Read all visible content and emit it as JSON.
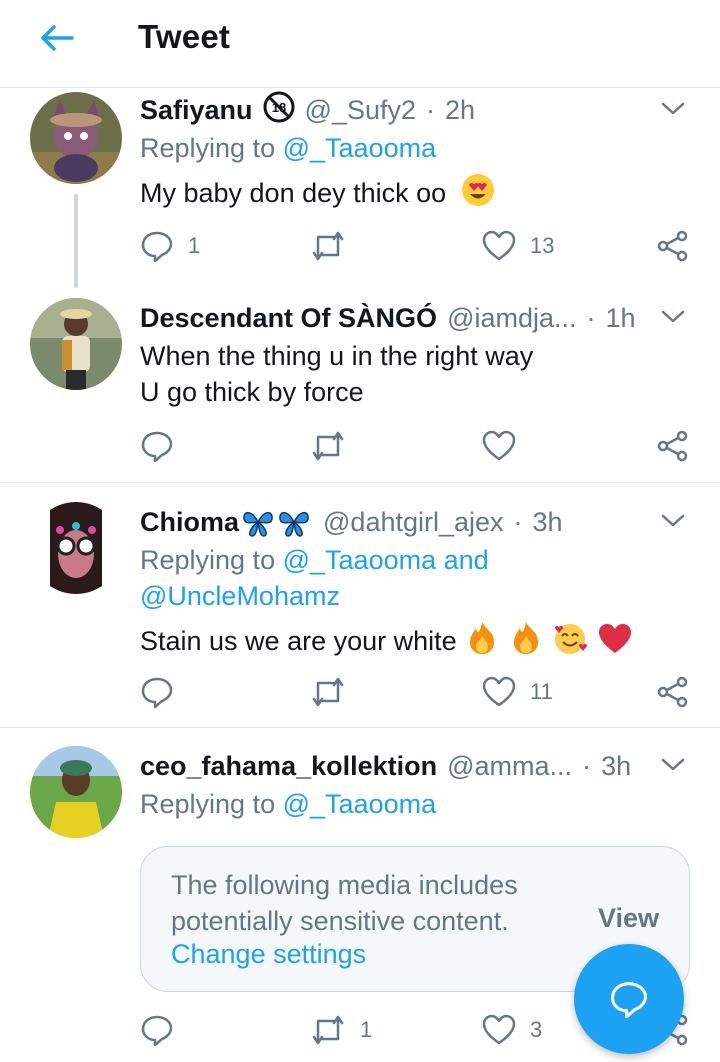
{
  "header": {
    "title": "Tweet"
  },
  "colors": {
    "accent": "#1da1f2",
    "secondary": "#657786",
    "text": "#14171a",
    "border": "#e1e8ed"
  },
  "tweets": [
    {
      "name": "Safiyanu",
      "handle": "@_Sufy2",
      "time": "2h",
      "badge": "no-under-18-icon",
      "reply_prefix": "Replying to",
      "reply_to": "@_Taaooma",
      "text_lines": [
        "My baby don dey thick oo"
      ],
      "emoji": "heart-eyes-emoji",
      "replies": "1",
      "retweets": "",
      "likes": "13"
    },
    {
      "name": "Descendant Of SÀNGÓ",
      "handle": "@iamdja...",
      "time": "1h",
      "text_lines": [
        "When the thing u in the right way",
        "U go thick by force"
      ],
      "replies": "",
      "retweets": "",
      "likes": ""
    },
    {
      "name": "Chioma",
      "name_emoji": "butterfly-emoji",
      "handle": "@dahtgirl_ajex",
      "time": "3h",
      "reply_prefix": "Replying to",
      "reply_to_line1": "@_Taaooma and",
      "reply_to_line2": "@UncleMohamz",
      "text_lines": [
        "Stain us we are your white"
      ],
      "emojis": [
        "fire-emoji",
        "fire-emoji",
        "smiling-hearts-emoji",
        "red-heart-emoji"
      ],
      "replies": "",
      "retweets": "",
      "likes": "11"
    },
    {
      "name": "ceo_fahama_kollektion",
      "handle": "@amma...",
      "time": "3h",
      "reply_prefix": "Replying to",
      "reply_to": "@_Taaooma",
      "replies": "",
      "retweets": "1",
      "likes": "3"
    }
  ],
  "sensitive": {
    "line1": "The following media includes",
    "line2": "potentially sensitive content.",
    "change": "Change settings",
    "view": "View"
  },
  "fab": {
    "icon": "compose-reply-icon"
  }
}
